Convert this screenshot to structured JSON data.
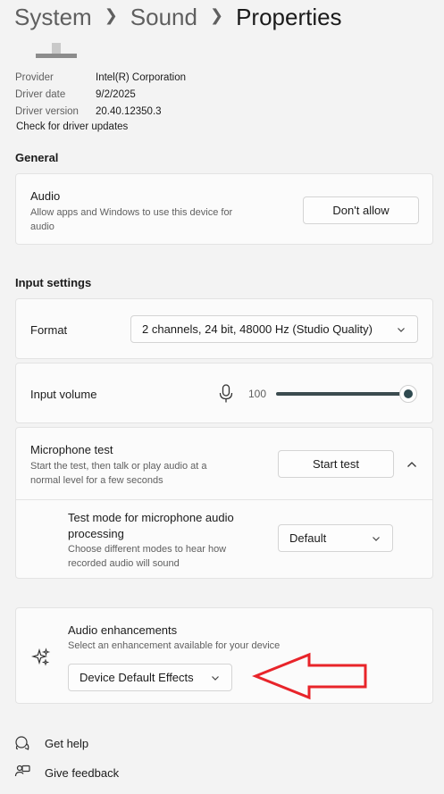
{
  "breadcrumb": {
    "items": [
      "System",
      "Sound"
    ],
    "current": "Properties"
  },
  "driver": {
    "provider_label": "Provider",
    "provider_value": "Intel(R) Corporation",
    "date_label": "Driver date",
    "date_value": "9/2/2025",
    "version_label": "Driver version",
    "version_value": "20.40.12350.3",
    "update_link": "Check for driver updates"
  },
  "general": {
    "title": "General",
    "audio_title": "Audio",
    "audio_desc_line1": "Allow apps and Windows to use this device for",
    "audio_desc_line2": "audio",
    "audio_button": "Don't allow"
  },
  "input_settings": {
    "title": "Input settings",
    "format_label": "Format",
    "format_value": "2 channels, 24 bit, 48000 Hz (Studio Quality)",
    "volume_label": "Input volume",
    "volume_value": "100",
    "volume_level": 1.0,
    "mic_test_title": "Microphone test",
    "mic_test_desc_line1": "Start the test, then talk or play audio at a",
    "mic_test_desc_line2": "normal level for a few seconds",
    "mic_test_button": "Start test",
    "test_mode_title_line1": "Test mode for microphone audio",
    "test_mode_title_line2": "processing",
    "test_mode_desc_line1": "Choose different modes to hear how",
    "test_mode_desc_line2": "recorded audio will sound",
    "test_mode_value": "Default"
  },
  "enhancements": {
    "title": "Audio enhancements",
    "desc": "Select an enhancement available for your device",
    "value": "Device Default Effects",
    "icon": "sparkle-icon"
  },
  "annotation": {
    "arrow_color": "#e8242a"
  },
  "footer": {
    "help": "Get help",
    "feedback": "Give feedback"
  },
  "colors": {
    "accent": "#2f4a50",
    "background": "#f3f3f3",
    "card": "#fbfbfb"
  }
}
